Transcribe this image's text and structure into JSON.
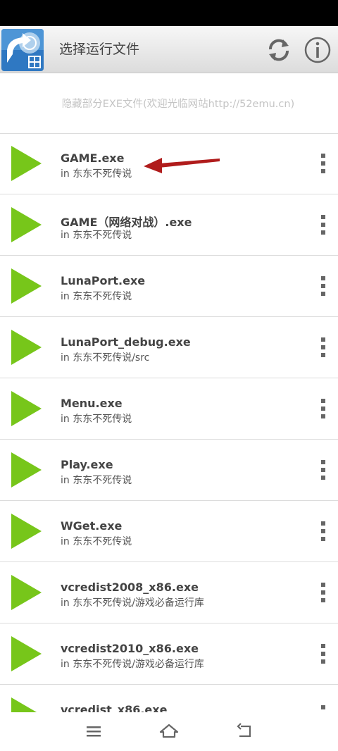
{
  "app_bar": {
    "title": "选择运行文件",
    "icons": {
      "refresh": "refresh-icon",
      "info": "info-icon",
      "app": "app-logo-icon"
    }
  },
  "notice": {
    "text": "隐藏部分EXE文件(欢迎光临网站http://52emu.cn)"
  },
  "files": [
    {
      "name": "GAME.exe",
      "path": "in 东东不死传说"
    },
    {
      "name": "GAME（网络对战）.exe",
      "path": "in 东东不死传说"
    },
    {
      "name": "LunaPort.exe",
      "path": "in 东东不死传说"
    },
    {
      "name": "LunaPort_debug.exe",
      "path": "in 东东不死传说/src"
    },
    {
      "name": "Menu.exe",
      "path": "in 东东不死传说"
    },
    {
      "name": "Play.exe",
      "path": "in 东东不死传说"
    },
    {
      "name": "WGet.exe",
      "path": "in 东东不死传说"
    },
    {
      "name": "vcredist2008_x86.exe",
      "path": "in 东东不死传说/游戏必备运行库"
    },
    {
      "name": "vcredist2010_x86.exe",
      "path": "in 东东不死传说/游戏必备运行库"
    },
    {
      "name": "vcredist_x86.exe",
      "path": ""
    }
  ],
  "colors": {
    "play_green": "#77c61a",
    "annotation_arrow": "#b01c1c",
    "status_bar": "#000000"
  },
  "nav": {
    "icons": [
      "menu-icon",
      "home-icon",
      "back-icon"
    ]
  }
}
